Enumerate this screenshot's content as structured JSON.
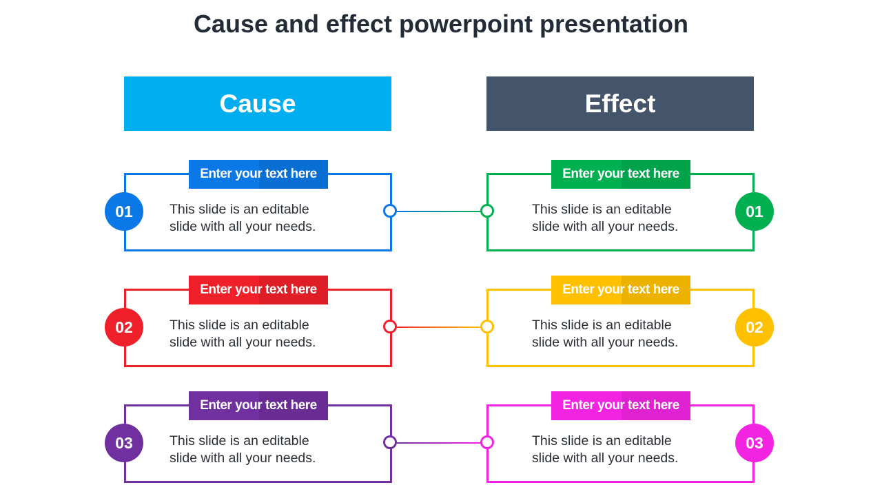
{
  "title": "Cause and effect powerpoint presentation",
  "headers": {
    "cause": {
      "label": "Cause",
      "color": "#00adef"
    },
    "effect": {
      "label": "Effect",
      "color": "#44546a"
    }
  },
  "cause_items": [
    {
      "number": "01",
      "tag": "Enter your text here",
      "text_line1": "This slide is an editable",
      "text_line2": "slide with all your needs.",
      "color": "#0a78e6"
    },
    {
      "number": "02",
      "tag": "Enter your text here",
      "text_line1": "This slide is an editable",
      "text_line2": "slide with all your needs.",
      "color": "#f0202a"
    },
    {
      "number": "03",
      "tag": "Enter your text here",
      "text_line1": "This slide is an editable",
      "text_line2": "slide with all your needs.",
      "color": "#7030a0"
    }
  ],
  "effect_items": [
    {
      "number": "01",
      "tag": "Enter your text here",
      "text_line1": "This slide is an editable",
      "text_line2": "slide with all your needs.",
      "color": "#00b050"
    },
    {
      "number": "02",
      "tag": "Enter your text here",
      "text_line1": "This slide is an editable",
      "text_line2": "slide with all your needs.",
      "color": "#ffc000"
    },
    {
      "number": "03",
      "tag": "Enter your text here",
      "text_line1": "This slide is an editable",
      "text_line2": "slide with all your needs.",
      "color": "#f224e2"
    }
  ]
}
